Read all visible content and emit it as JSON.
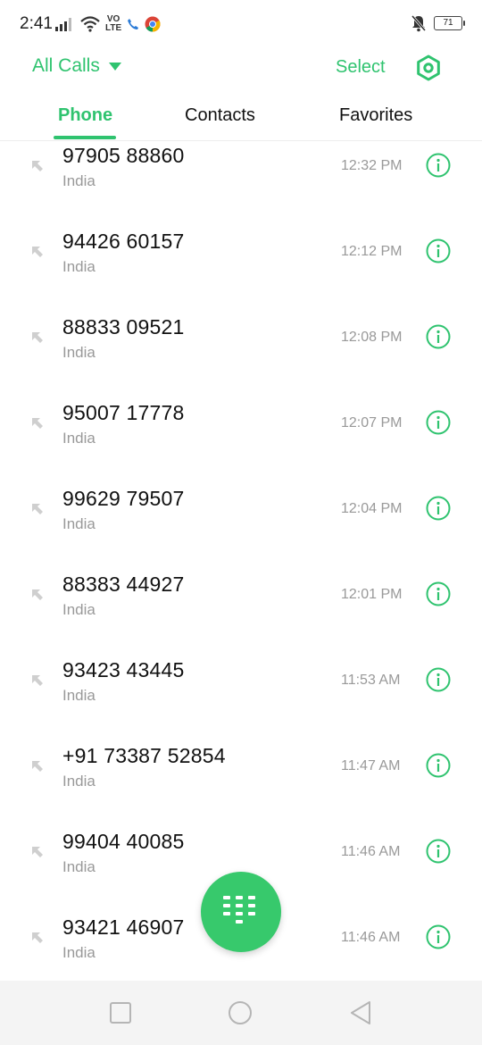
{
  "status_bar": {
    "time": "2:41",
    "volte_line1": "VO",
    "volte_line2": "LTE",
    "battery": "71"
  },
  "header": {
    "filter_label": "All Calls",
    "select_label": "Select"
  },
  "tabs": [
    {
      "label": "Phone",
      "active": true
    },
    {
      "label": "Contacts",
      "active": false
    },
    {
      "label": "Favorites",
      "active": false
    }
  ],
  "calls": [
    {
      "number": "97905 88860",
      "location": "India",
      "time": "12:32 PM"
    },
    {
      "number": "94426 60157",
      "location": "India",
      "time": "12:12 PM"
    },
    {
      "number": "88833 09521",
      "location": "India",
      "time": "12:08 PM"
    },
    {
      "number": "95007 17778",
      "location": "India",
      "time": "12:07 PM"
    },
    {
      "number": "99629 79507",
      "location": "India",
      "time": "12:04 PM"
    },
    {
      "number": "88383 44927",
      "location": "India",
      "time": "12:01 PM"
    },
    {
      "number": "93423 43445",
      "location": "India",
      "time": "11:53 AM"
    },
    {
      "number": "+91 73387 52854",
      "location": "India",
      "time": "11:47 AM"
    },
    {
      "number": "99404 40085",
      "location": "India",
      "time": "11:46 AM"
    },
    {
      "number": "93421 46907",
      "location": "India",
      "time": "11:46 AM"
    }
  ],
  "colors": {
    "accent": "#2fc36f",
    "fab": "#37c96c"
  }
}
